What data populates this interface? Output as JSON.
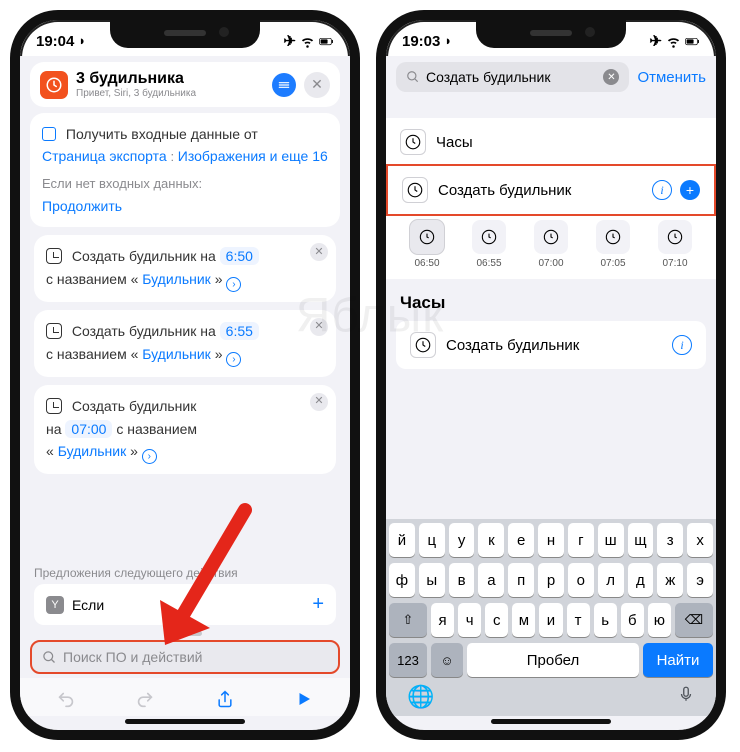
{
  "watermark": "Яблык",
  "left": {
    "status_time": "19:04",
    "header_title": "3 будильника",
    "header_sub": "Привет, Siri, 3 будильника",
    "card1": {
      "prefix": "Получить входные данные от",
      "source": "Страница экспорта",
      "types": "Изображения и еще 16",
      "fallback_label": "Если нет входных данных:",
      "fallback_action": "Продолжить"
    },
    "alarms": [
      {
        "pre": "Создать будильник на",
        "time": "6:50",
        "name_pre": "с названием «",
        "name": "Будильник",
        "name_post": "»"
      },
      {
        "pre": "Создать будильник на",
        "time": "6:55",
        "name_pre": "с названием «",
        "name": "Будильник",
        "name_post": "»"
      },
      {
        "pre": "Создать будильник",
        "on": "на",
        "time": "07:00",
        "name_pre": "с названием",
        "q1": "«",
        "name": "Будильник",
        "q2": "»"
      }
    ],
    "suggest_label": "Предложения следующего действия",
    "suggest_item": "Если",
    "search_placeholder": "Поиск ПО и действий"
  },
  "right": {
    "status_time": "19:03",
    "search_value": "Создать будильник",
    "cancel": "Отменить",
    "row_clock": "Часы",
    "row_create": "Создать будильник",
    "times": [
      "06:50",
      "06:55",
      "07:00",
      "07:05",
      "07:10"
    ],
    "section": "Часы",
    "row_create2": "Создать будильник",
    "keys_r1": [
      "й",
      "ц",
      "у",
      "к",
      "е",
      "н",
      "г",
      "ш",
      "щ",
      "з",
      "х"
    ],
    "keys_r2": [
      "ф",
      "ы",
      "в",
      "а",
      "п",
      "р",
      "о",
      "л",
      "д",
      "ж",
      "э"
    ],
    "keys_r3": [
      "я",
      "ч",
      "с",
      "м",
      "и",
      "т",
      "ь",
      "б",
      "ю"
    ],
    "key_123": "123",
    "key_space": "Пробел",
    "key_find": "Найти"
  }
}
